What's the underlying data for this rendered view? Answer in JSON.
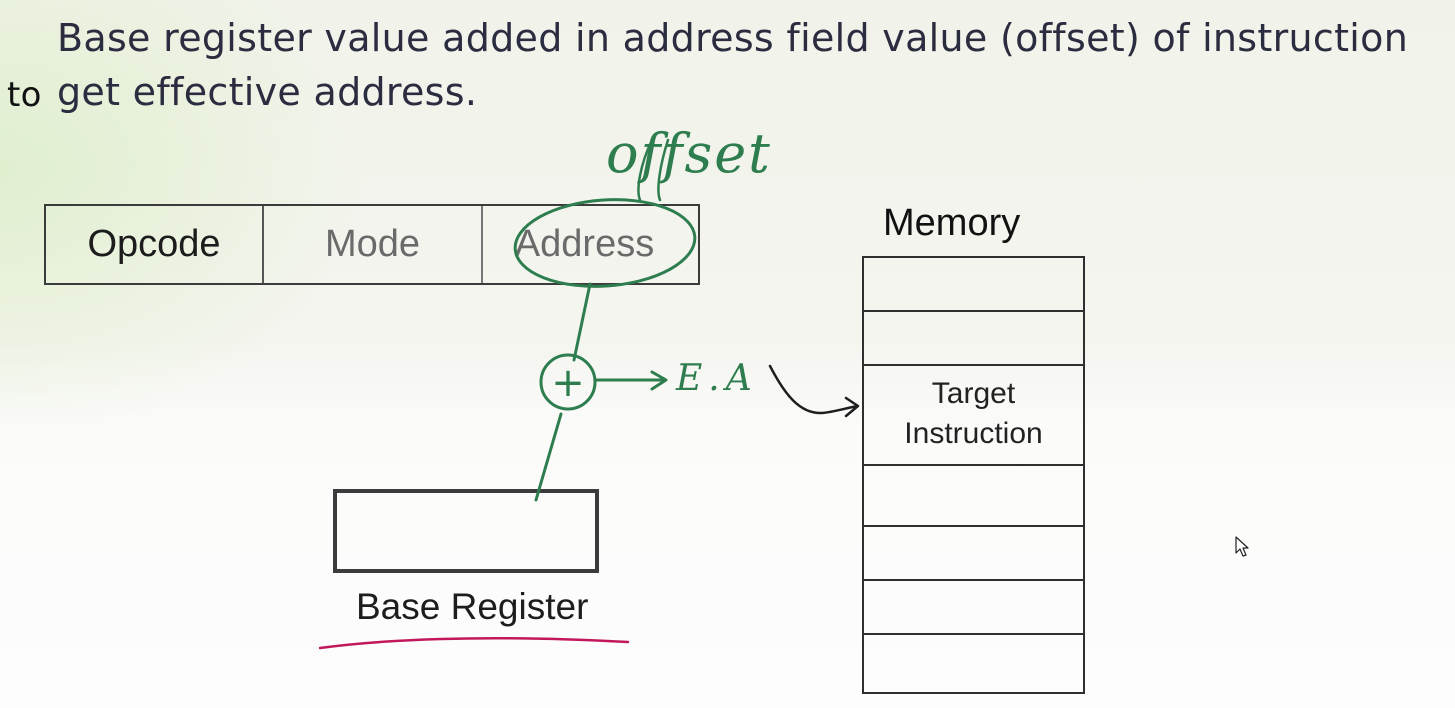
{
  "heading": {
    "line1": "Base register value added in address field value (offset) of instruction",
    "line2": "get effective address.",
    "prefix": "to"
  },
  "instruction_format": {
    "fields": [
      "Opcode",
      "Mode",
      "Address"
    ]
  },
  "annotations": {
    "offset": "offset",
    "plus": "+",
    "effective_address": "E.A"
  },
  "base_register": {
    "label": "Base Register"
  },
  "memory": {
    "label": "Memory",
    "target_line1": "Target",
    "target_line2": "Instruction"
  },
  "colors": {
    "ink_green": "#2e7d4f",
    "underline_pink": "#c2185b",
    "text_dark": "#2b2c3f"
  },
  "icons": {
    "cursor": "mouse-pointer-icon"
  }
}
